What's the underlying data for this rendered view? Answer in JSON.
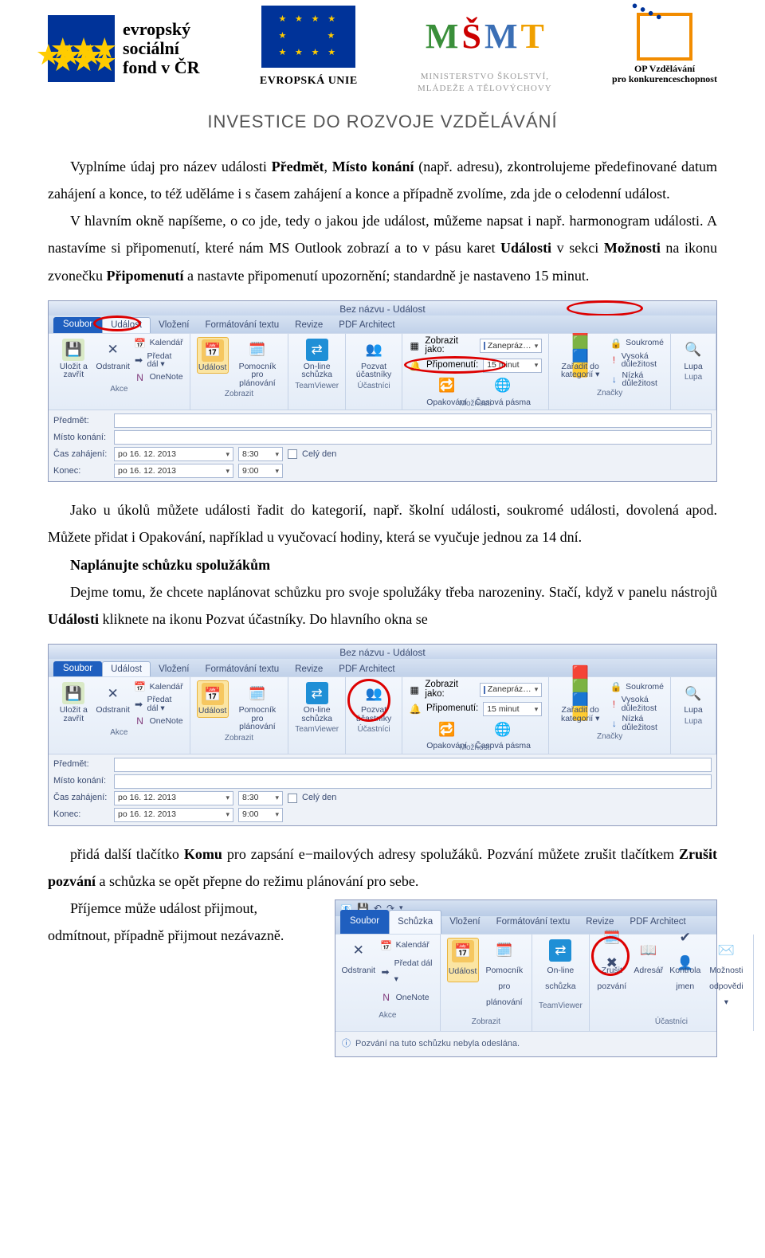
{
  "logos": {
    "esf_text": "evropský\nsociální\nfond v ČR",
    "eu_label": "EVROPSKÁ UNIE",
    "msmt_line1": "MINISTERSTVO ŠKOLSTVÍ,",
    "msmt_line2": "MLÁDEŽE A TĚLOVÝCHOVY",
    "opvk_line1": "OP Vzdělávání",
    "opvk_line2": "pro konkurenceschopnost"
  },
  "banner": "INVESTICE DO ROZVOJE VZDĚLÁVÁNÍ",
  "para1_a": "Vyplníme údaj pro název události ",
  "para1_b": "Předmět",
  "para1_c": ", ",
  "para1_d": "Místo konání",
  "para1_e": " (např. adresu), zkontrolujeme předefinované datum zahájení a konce, to též uděláme i s časem zahájení a konce a případně zvolíme, zda jde o celodenní událost.",
  "para2_a": "V hlavním okně napíšeme, o co jde, tedy o jakou jde událost, můžeme napsat i např. harmonogram události. A nastavíme si připomenutí, které nám MS Outlook zobrazí a to v pásu karet ",
  "para2_b": "Události",
  "para2_c": " v sekci ",
  "para2_d": "Možnosti",
  "para2_e": " na ikonu zvonečku ",
  "para2_f": "Připomenutí",
  "para2_g": " a nastavte připomenutí upozornění; standardně je nastaveno 15 minut.",
  "para3": "Jako u úkolů můžete události řadit do kategorií, např. školní události, soukromé události, dovolená apod. Můžete přidat i Opakování, například u vyučovací hodiny, která se vyučuje jednou za 14 dní.",
  "para4_title": "Naplánujte schůzku spolužákům",
  "para4_a": "Dejme tomu, že chcete naplánovat schůzku pro svoje spolužáky třeba narozeniny. Stačí, když v panelu nástrojů ",
  "para4_b": "Události",
  "para4_c": " kliknete na ikonu Pozvat účastníky. Do hlavního okna se ",
  "para5_a": "přidá další tlačítko ",
  "para5_b": "Komu",
  "para5_c": " pro zapsání e−mailových adresy spolužáků. Pozvání můžete zrušit tlačítkem ",
  "para5_d": "Zrušit pozvání",
  "para5_e": " a schůzka se opět přepne do režimu plánování pro sebe.",
  "para6": "Příjemce může událost přijmout, odmítnout, případně přijmout nezávazně.",
  "outlook": {
    "title": "Bez názvu - Událost",
    "tabs": {
      "file": "Soubor",
      "event": "Událost",
      "insert": "Vložení",
      "format": "Formátování textu",
      "review": "Revize",
      "pdf": "PDF Architect"
    },
    "actions": {
      "save": "Uložit a zavřít",
      "delete": "Odstranit",
      "cal": "Kalendář",
      "fwd": "Předat dál ▾",
      "onenote": "OneNote",
      "group": "Akce"
    },
    "show": {
      "event": "Událost",
      "assistant": "Pomocník pro plánování",
      "group": "Zobrazit"
    },
    "tv": {
      "online": "On-line schůzka",
      "group": "TeamViewer"
    },
    "participants": {
      "invite": "Pozvat účastníky",
      "cancel": "Zrušit pozvání",
      "group": "Účastníci",
      "address": "Adresář",
      "check": "Kontrola jmen",
      "resp": "Možnosti odpovědi ▾"
    },
    "options": {
      "showas_label": "Zobrazit jako:",
      "showas_value": "Zanepráz…",
      "reminder_label": "Připomenutí:",
      "reminder_value": "15 minut",
      "recurrence": "Opakování",
      "tz": "Časová pásma",
      "group": "Možnosti"
    },
    "categorize": {
      "btn": "Zařadit do kategorií ▾",
      "private": "Soukromé",
      "high": "Vysoká důležitost",
      "low": "Nízká důležitost",
      "group": "Značky"
    },
    "zoom": {
      "btn": "Lupa",
      "group": "Lupa"
    },
    "fields": {
      "subject": "Předmět:",
      "location": "Místo konání:",
      "start": "Čas zahájení:",
      "end": "Konec:",
      "date": "po 16. 12. 2013",
      "t_start": "8:30",
      "t_end": "9:00",
      "allday": "Celý den"
    }
  },
  "meeting": {
    "tabs": {
      "file": "Soubor",
      "meeting": "Schůzka",
      "insert": "Vložení",
      "format": "Formátování textu",
      "review": "Revize",
      "pdf": "PDF Architect"
    },
    "info": "Pozvání na tuto schůzku nebyla odeslána."
  }
}
